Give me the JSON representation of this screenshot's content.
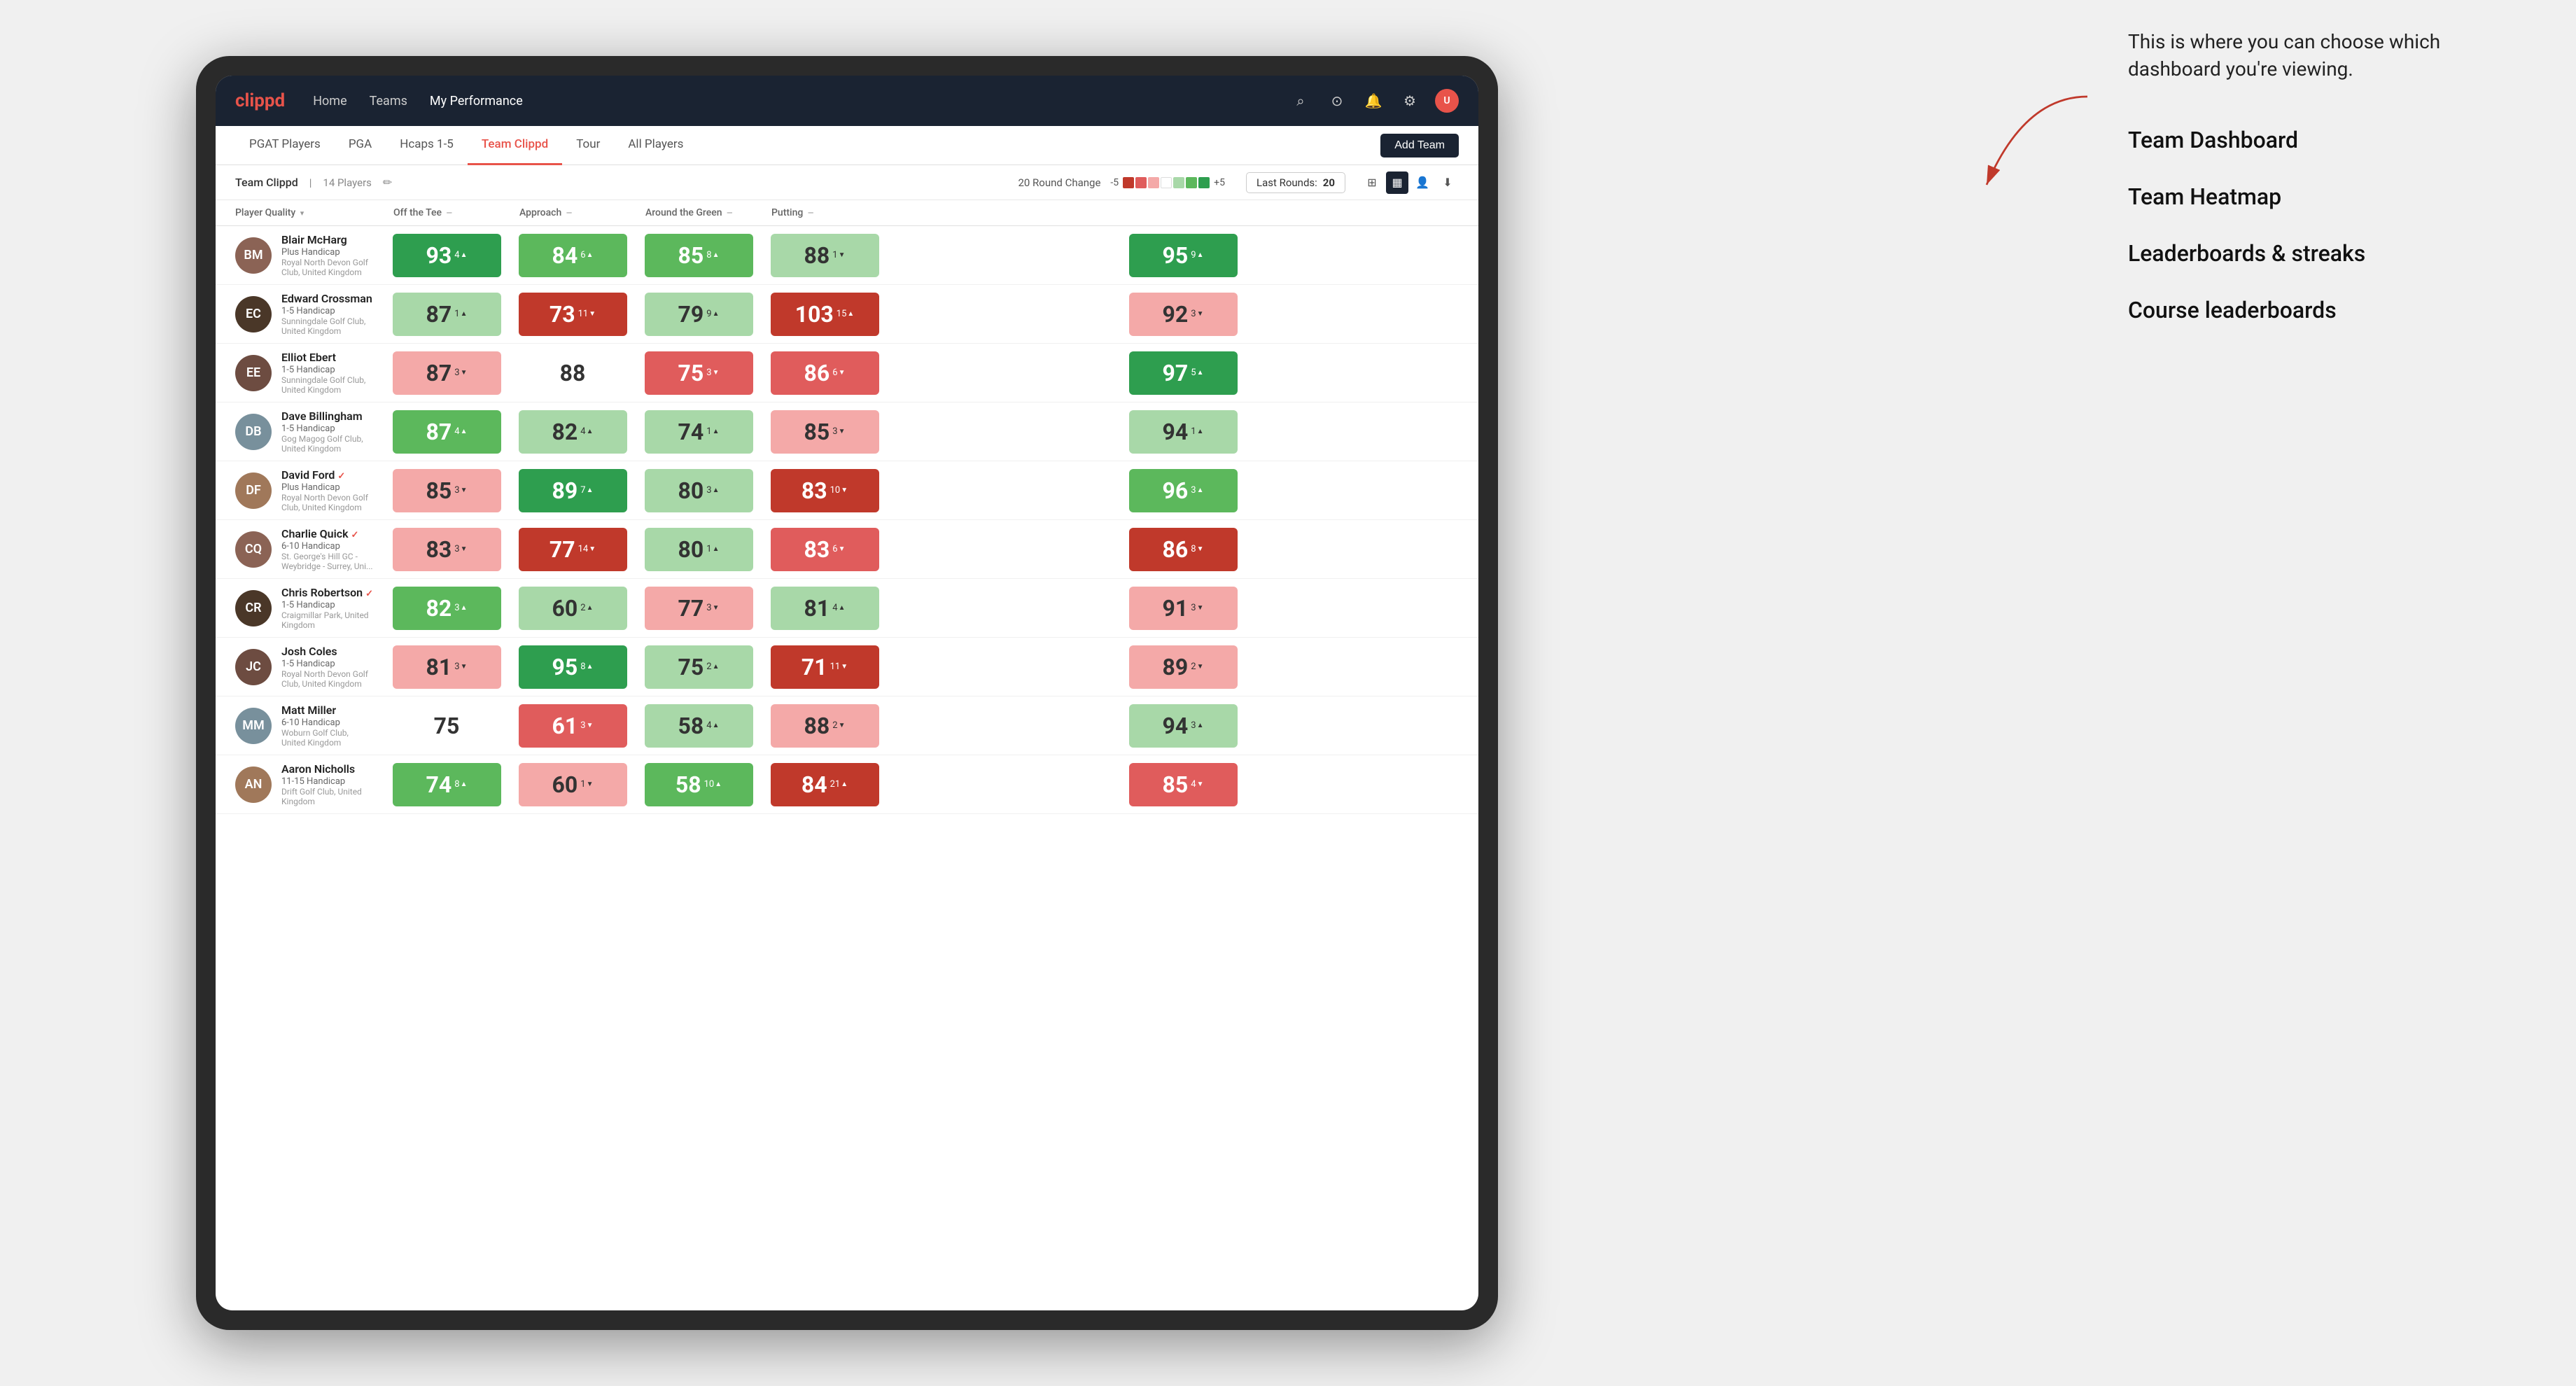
{
  "annotation": {
    "text": "This is where you can choose which dashboard you're viewing.",
    "options": [
      "Team Dashboard",
      "Team Heatmap",
      "Leaderboards & streaks",
      "Course leaderboards"
    ]
  },
  "nav": {
    "logo": "clippd",
    "links": [
      "Home",
      "Teams",
      "My Performance"
    ],
    "active_link": "My Performance"
  },
  "sub_nav": {
    "links": [
      "PGAT Players",
      "PGA",
      "Hcaps 1-5",
      "Team Clippd",
      "Tour",
      "All Players"
    ],
    "active": "Team Clippd",
    "add_team": "Add Team"
  },
  "team_bar": {
    "name": "Team Clippd",
    "separator": "|",
    "count": "14 Players",
    "round_change_label": "20 Round Change",
    "scale_min": "-5",
    "scale_max": "+5",
    "last_rounds_label": "Last Rounds:",
    "last_rounds_value": "20"
  },
  "columns": {
    "player": "Player Quality",
    "off_tee": "Off the Tee",
    "approach": "Approach",
    "around_green": "Around the Green",
    "putting": "Putting"
  },
  "players": [
    {
      "name": "Blair McHarg",
      "handicap": "Plus Handicap",
      "club": "Royal North Devon Golf Club, United Kingdom",
      "avatar_color": "av-brown",
      "initials": "BM",
      "player_quality": {
        "score": "93",
        "change": "4",
        "dir": "up",
        "color": "green-dark"
      },
      "off_tee": {
        "score": "84",
        "change": "6",
        "dir": "up",
        "color": "green-med"
      },
      "approach": {
        "score": "85",
        "change": "8",
        "dir": "up",
        "color": "green-med"
      },
      "around_green": {
        "score": "88",
        "change": "1",
        "dir": "down",
        "color": "green-light"
      },
      "putting": {
        "score": "95",
        "change": "9",
        "dir": "up",
        "color": "green-dark"
      }
    },
    {
      "name": "Edward Crossman",
      "handicap": "1-5 Handicap",
      "club": "Sunningdale Golf Club, United Kingdom",
      "avatar_color": "av-dark",
      "initials": "EC",
      "player_quality": {
        "score": "87",
        "change": "1",
        "dir": "up",
        "color": "green-light"
      },
      "off_tee": {
        "score": "73",
        "change": "11",
        "dir": "down",
        "color": "red-dark"
      },
      "approach": {
        "score": "79",
        "change": "9",
        "dir": "up",
        "color": "green-light"
      },
      "around_green": {
        "score": "103",
        "change": "15",
        "dir": "up",
        "color": "red-dark"
      },
      "putting": {
        "score": "92",
        "change": "3",
        "dir": "down",
        "color": "red-light"
      }
    },
    {
      "name": "Elliot Ebert",
      "handicap": "1-5 Handicap",
      "club": "Sunningdale Golf Club, United Kingdom",
      "avatar_color": "av-medium",
      "initials": "EE",
      "player_quality": {
        "score": "87",
        "change": "3",
        "dir": "down",
        "color": "red-light"
      },
      "off_tee": {
        "score": "88",
        "change": "",
        "dir": "",
        "color": "white"
      },
      "approach": {
        "score": "75",
        "change": "3",
        "dir": "down",
        "color": "red-med"
      },
      "around_green": {
        "score": "86",
        "change": "6",
        "dir": "down",
        "color": "red-med"
      },
      "putting": {
        "score": "97",
        "change": "5",
        "dir": "up",
        "color": "green-dark"
      }
    },
    {
      "name": "Dave Billingham",
      "handicap": "1-5 Handicap",
      "club": "Gog Magog Golf Club, United Kingdom",
      "avatar_color": "av-gray",
      "initials": "DB",
      "player_quality": {
        "score": "87",
        "change": "4",
        "dir": "up",
        "color": "green-med"
      },
      "off_tee": {
        "score": "82",
        "change": "4",
        "dir": "up",
        "color": "green-light"
      },
      "approach": {
        "score": "74",
        "change": "1",
        "dir": "up",
        "color": "green-light"
      },
      "around_green": {
        "score": "85",
        "change": "3",
        "dir": "down",
        "color": "red-light"
      },
      "putting": {
        "score": "94",
        "change": "1",
        "dir": "up",
        "color": "green-light"
      }
    },
    {
      "name": "David Ford",
      "handicap": "Plus Handicap",
      "club": "Royal North Devon Golf Club, United Kingdom",
      "avatar_color": "av-tan",
      "initials": "DF",
      "verified": true,
      "player_quality": {
        "score": "85",
        "change": "3",
        "dir": "down",
        "color": "red-light"
      },
      "off_tee": {
        "score": "89",
        "change": "7",
        "dir": "up",
        "color": "green-dark"
      },
      "approach": {
        "score": "80",
        "change": "3",
        "dir": "up",
        "color": "green-light"
      },
      "around_green": {
        "score": "83",
        "change": "10",
        "dir": "down",
        "color": "red-dark"
      },
      "putting": {
        "score": "96",
        "change": "3",
        "dir": "up",
        "color": "green-med"
      }
    },
    {
      "name": "Charlie Quick",
      "handicap": "6-10 Handicap",
      "club": "St. George's Hill GC - Weybridge - Surrey, Uni...",
      "avatar_color": "av-brown",
      "initials": "CQ",
      "verified": true,
      "player_quality": {
        "score": "83",
        "change": "3",
        "dir": "down",
        "color": "red-light"
      },
      "off_tee": {
        "score": "77",
        "change": "14",
        "dir": "down",
        "color": "red-dark"
      },
      "approach": {
        "score": "80",
        "change": "1",
        "dir": "up",
        "color": "green-light"
      },
      "around_green": {
        "score": "83",
        "change": "6",
        "dir": "down",
        "color": "red-med"
      },
      "putting": {
        "score": "86",
        "change": "8",
        "dir": "down",
        "color": "red-dark"
      }
    },
    {
      "name": "Chris Robertson",
      "handicap": "1-5 Handicap",
      "club": "Craigmillar Park, United Kingdom",
      "avatar_color": "av-dark",
      "initials": "CR",
      "verified": true,
      "player_quality": {
        "score": "82",
        "change": "3",
        "dir": "up",
        "color": "green-med"
      },
      "off_tee": {
        "score": "60",
        "change": "2",
        "dir": "up",
        "color": "green-light"
      },
      "approach": {
        "score": "77",
        "change": "3",
        "dir": "down",
        "color": "red-light"
      },
      "around_green": {
        "score": "81",
        "change": "4",
        "dir": "up",
        "color": "green-light"
      },
      "putting": {
        "score": "91",
        "change": "3",
        "dir": "down",
        "color": "red-light"
      }
    },
    {
      "name": "Josh Coles",
      "handicap": "1-5 Handicap",
      "club": "Royal North Devon Golf Club, United Kingdom",
      "avatar_color": "av-medium",
      "initials": "JC",
      "player_quality": {
        "score": "81",
        "change": "3",
        "dir": "down",
        "color": "red-light"
      },
      "off_tee": {
        "score": "95",
        "change": "8",
        "dir": "up",
        "color": "green-dark"
      },
      "approach": {
        "score": "75",
        "change": "2",
        "dir": "up",
        "color": "green-light"
      },
      "around_green": {
        "score": "71",
        "change": "11",
        "dir": "down",
        "color": "red-dark"
      },
      "putting": {
        "score": "89",
        "change": "2",
        "dir": "down",
        "color": "red-light"
      }
    },
    {
      "name": "Matt Miller",
      "handicap": "6-10 Handicap",
      "club": "Woburn Golf Club, United Kingdom",
      "avatar_color": "av-gray",
      "initials": "MM",
      "player_quality": {
        "score": "75",
        "change": "",
        "dir": "",
        "color": "white"
      },
      "off_tee": {
        "score": "61",
        "change": "3",
        "dir": "down",
        "color": "red-med"
      },
      "approach": {
        "score": "58",
        "change": "4",
        "dir": "up",
        "color": "green-light"
      },
      "around_green": {
        "score": "88",
        "change": "2",
        "dir": "down",
        "color": "red-light"
      },
      "putting": {
        "score": "94",
        "change": "3",
        "dir": "up",
        "color": "green-light"
      }
    },
    {
      "name": "Aaron Nicholls",
      "handicap": "11-15 Handicap",
      "club": "Drift Golf Club, United Kingdom",
      "avatar_color": "av-tan",
      "initials": "AN",
      "player_quality": {
        "score": "74",
        "change": "8",
        "dir": "up",
        "color": "green-med"
      },
      "off_tee": {
        "score": "60",
        "change": "1",
        "dir": "down",
        "color": "red-light"
      },
      "approach": {
        "score": "58",
        "change": "10",
        "dir": "up",
        "color": "green-med"
      },
      "around_green": {
        "score": "84",
        "change": "21",
        "dir": "up",
        "color": "red-dark"
      },
      "putting": {
        "score": "85",
        "change": "4",
        "dir": "down",
        "color": "red-med"
      }
    }
  ],
  "icons": {
    "search": "🔍",
    "user": "👤",
    "bell": "🔔",
    "settings": "⚙",
    "grid": "⊞",
    "list": "☰",
    "download": "⬇",
    "edit": "✎",
    "calendar": "📅",
    "verified": "✓"
  }
}
